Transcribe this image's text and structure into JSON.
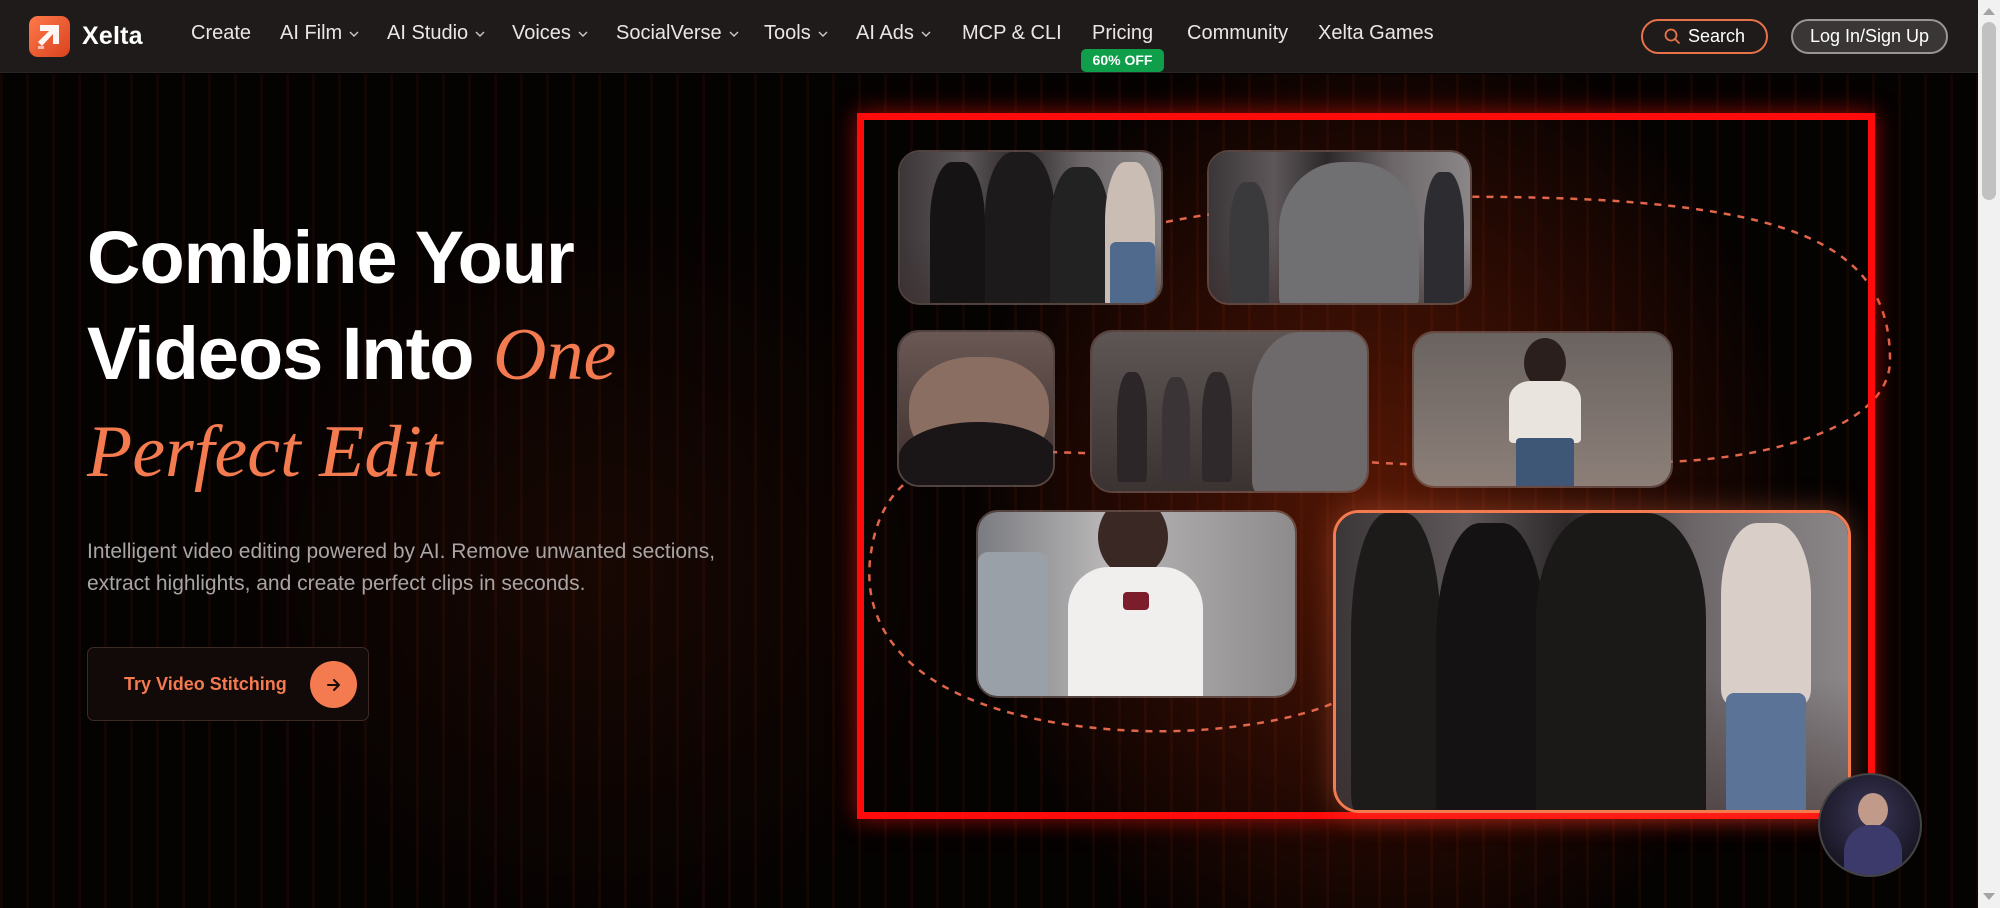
{
  "brand": {
    "name": "Xelta",
    "accent": "#f47a50"
  },
  "nav": {
    "items": [
      {
        "label": "Create",
        "dropdown": false
      },
      {
        "label": "AI Film",
        "dropdown": true
      },
      {
        "label": "AI Studio",
        "dropdown": true
      },
      {
        "label": "Voices",
        "dropdown": true
      },
      {
        "label": "SocialVerse",
        "dropdown": true
      },
      {
        "label": "Tools",
        "dropdown": true
      },
      {
        "label": "AI Ads",
        "dropdown": true
      },
      {
        "label": "MCP & CLI",
        "dropdown": false
      },
      {
        "label": "Pricing",
        "dropdown": false
      },
      {
        "label": "Community",
        "dropdown": false
      },
      {
        "label": "Xelta Games",
        "dropdown": false
      }
    ],
    "pricing_badge": "60% OFF",
    "search_label": "Search",
    "login_label": "Log In/Sign Up"
  },
  "hero": {
    "line1": "Combine Your",
    "line2": "Videos Into ",
    "accent1": "One",
    "accent2": "Perfect Edit",
    "subtitle": "Intelligent video editing powered by AI. Remove unwanted sections, extract highlights, and create perfect clips in seconds.",
    "cta_label": "Try Video Stitching"
  },
  "colors": {
    "nav_bg": "#1f1b1a",
    "highlight_frame": "#ff0b0b",
    "badge_green": "#0f9f4a"
  },
  "icons": {
    "logo": "xelta-logo-icon",
    "search": "search-icon",
    "chevron": "chevron-down-icon",
    "cta": "arrow-right-icon"
  }
}
